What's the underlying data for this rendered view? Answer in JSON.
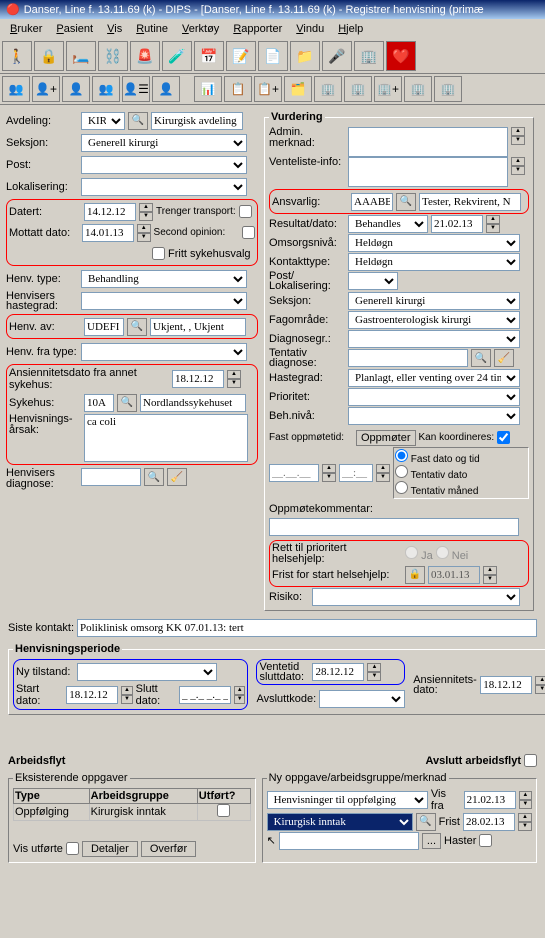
{
  "title": "Danser, Line f. 13.11.69 (k) - DIPS - [Danser, Line f. 13.11.69 (k) - Registrer henvisning (primæ",
  "menu": [
    "Bruker",
    "Pasient",
    "Vis",
    "Rutine",
    "Verktøy",
    "Rapporter",
    "Vindu",
    "Hjelp"
  ],
  "left": {
    "avdeling_lbl": "Avdeling:",
    "avdeling": "KIR",
    "avdeling_btn": "Kirurgisk avdeling",
    "seksjon_lbl": "Seksjon:",
    "seksjon": "Generell kirurgi",
    "post_lbl": "Post:",
    "post": "",
    "lokalisering_lbl": "Lokalisering:",
    "lokalisering": "",
    "datert_lbl": "Datert:",
    "datert": "14.12.12",
    "trenger": "Trenger transport:",
    "second": "Second opinion:",
    "mottatt_lbl": "Mottatt dato:",
    "mottatt": "14.01.13",
    "fritt": "Fritt sykehusvalg",
    "henvtype_lbl": "Henv. type:",
    "henvtype": "Behandling",
    "hastegrad_lbl": "Henvisers hastegrad:",
    "hastegrad": "",
    "henvav_lbl": "Henv. av:",
    "henvav": "UDEFI",
    "henvav_txt": "Ukjent, , Ukjent",
    "fratype_lbl": "Henv. fra type:",
    "fratype": "",
    "ansdato_lbl": "Ansiennitetsdato fra annet sykehus:",
    "ansdato": "18.12.12",
    "sykehus_lbl": "Sykehus:",
    "sykehus": "10A",
    "sykehus_txt": "Nordlandssykehuset",
    "arsak_lbl": "Henvisnings-\nårsak:",
    "arsak": "ca coli",
    "diagnose_lbl": "Henvisers diagnose:",
    "diagnose": ""
  },
  "vurdering": {
    "title": "Vurdering",
    "admin_lbl": "Admin. merknad:",
    "admin": "",
    "vent_lbl": "Venteliste-info:",
    "vent": "",
    "ansvarlig_lbl": "Ansvarlig:",
    "ansvarlig": "AAABB",
    "ansvarlig_txt": "Tester, Rekvirent, N",
    "resultat_lbl": "Resultat/dato:",
    "resultat": "Behandles",
    "resultat_dato": "21.02.13",
    "omsorg_lbl": "Omsorgsnivå:",
    "omsorg": "Heldøgn",
    "kontakt_lbl": "Kontakttype:",
    "kontakt": "Heldøgn",
    "postlok_lbl": "Post/\nLokalisering:",
    "seksjon_lbl": "Seksjon:",
    "seksjon": "Generell kirurgi",
    "fag_lbl": "Fagområde:",
    "fag": "Gastroenterologisk kirurgi",
    "diagsegr_lbl": "Diagnosegr.:",
    "tentdiag_lbl": "Tentativ diagnose:",
    "hastegrad_lbl": "Hastegrad:",
    "hastegrad": "Planlagt, eller venting over 24 tim",
    "prioritet_lbl": "Prioritet:",
    "behniva_lbl": "Beh.nivå:",
    "fastopp_lbl": "Fast oppmøtetid:",
    "oppmoter": "Oppmøter",
    "kankoord": "Kan koordineres:",
    "r1": "Fast dato og tid",
    "r2": "Tentativ dato",
    "r3": "Tentativ måned",
    "oppkomm_lbl": "Oppmøtekommentar:",
    "rett_lbl": "Rett til prioritert helsehjelp:",
    "ja": "Ja",
    "nei": "Nei",
    "frist_lbl": "Frist for start helsehjelp:",
    "frist": "03.01.13",
    "risiko_lbl": "Risiko:"
  },
  "siste": {
    "lbl": "Siste kontakt:",
    "val": "Poliklinisk omsorg KK 07.01.13: tert"
  },
  "periode": {
    "title": "Henvisningsperiode",
    "ny_lbl": "Ny tilstand:",
    "ny": "",
    "start_lbl": "Start dato:",
    "start": "18.12.12",
    "slutt_lbl": "Slutt dato:",
    "slutt": "_ _._ _._ _",
    "ventetid_lbl": "Ventetid sluttdato:",
    "ventetid": "28.12.12",
    "ans_lbl": "Ansiennitets-dato:",
    "ans": "18.12.12",
    "avslutt_lbl": "Avsluttkode:"
  },
  "arbeid": {
    "title": "Arbeidsflyt",
    "avsl": "Avslutt arbeidsflyt",
    "eksist": "Eksisterende oppgaver",
    "nyopp": "Ny oppgave/arbeidsgruppe/merknad",
    "col1": "Type",
    "col2": "Arbeidsgruppe",
    "col3": "Utført?",
    "row1a": "Oppfølging",
    "row1b": "Kirurgisk inntak",
    "henvis": "Henvisninger til oppfølging",
    "kirinn": "Kirurgisk inntak",
    "visfra_lbl": "Vis fra",
    "visfra": "21.02.13",
    "frist_lbl": "Frist",
    "frist": "28.02.13",
    "haster": "Haster",
    "visutf": "Vis utførte",
    "detaljer": "Detaljer",
    "overfor": "Overfør"
  }
}
